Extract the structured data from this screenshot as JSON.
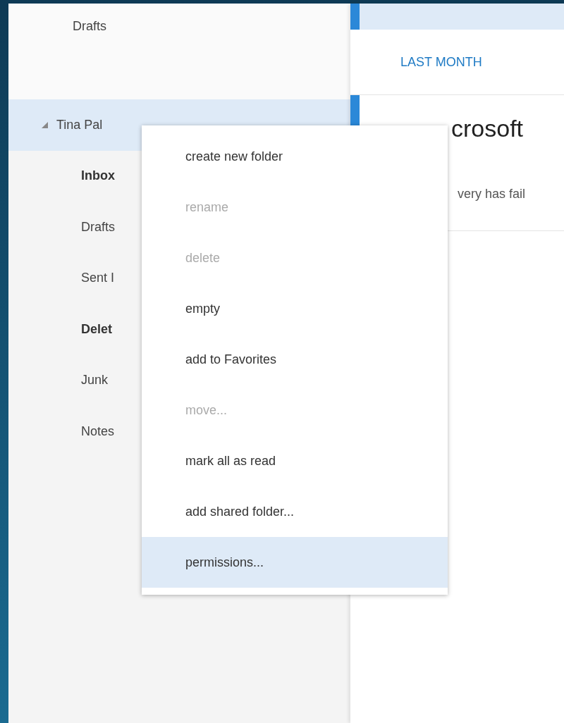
{
  "sidebar": {
    "favorites": [
      {
        "label": "Drafts"
      }
    ],
    "account": {
      "name": "Tina Pal",
      "expanded": true,
      "selected": true,
      "folders": [
        {
          "label": "Inbox",
          "unread": true
        },
        {
          "label": "Drafts",
          "unread": false
        },
        {
          "label": "Sent I",
          "unread": false
        },
        {
          "label": "Delet",
          "unread": true
        },
        {
          "label": "Junk",
          "unread": false
        },
        {
          "label": "Notes",
          "unread": false
        }
      ]
    }
  },
  "message_list": {
    "top_message": {
      "selected": true
    },
    "groups": [
      {
        "header": "LAST MONTH",
        "messages": [
          {
            "title": "crosoft",
            "preview": "very has fail",
            "unread": true
          }
        ]
      }
    ]
  },
  "context_menu": {
    "items": [
      {
        "label": "create new folder",
        "disabled": false,
        "selected": false
      },
      {
        "label": "rename",
        "disabled": true,
        "selected": false
      },
      {
        "label": "delete",
        "disabled": true,
        "selected": false
      },
      {
        "label": "empty",
        "disabled": false,
        "selected": false
      },
      {
        "label": "add to Favorites",
        "disabled": false,
        "selected": false
      },
      {
        "label": "move...",
        "disabled": true,
        "selected": false
      },
      {
        "label": "mark all as read",
        "disabled": false,
        "selected": false
      },
      {
        "label": "add shared folder...",
        "disabled": false,
        "selected": false
      },
      {
        "label": "permissions...",
        "disabled": false,
        "selected": true
      }
    ]
  }
}
